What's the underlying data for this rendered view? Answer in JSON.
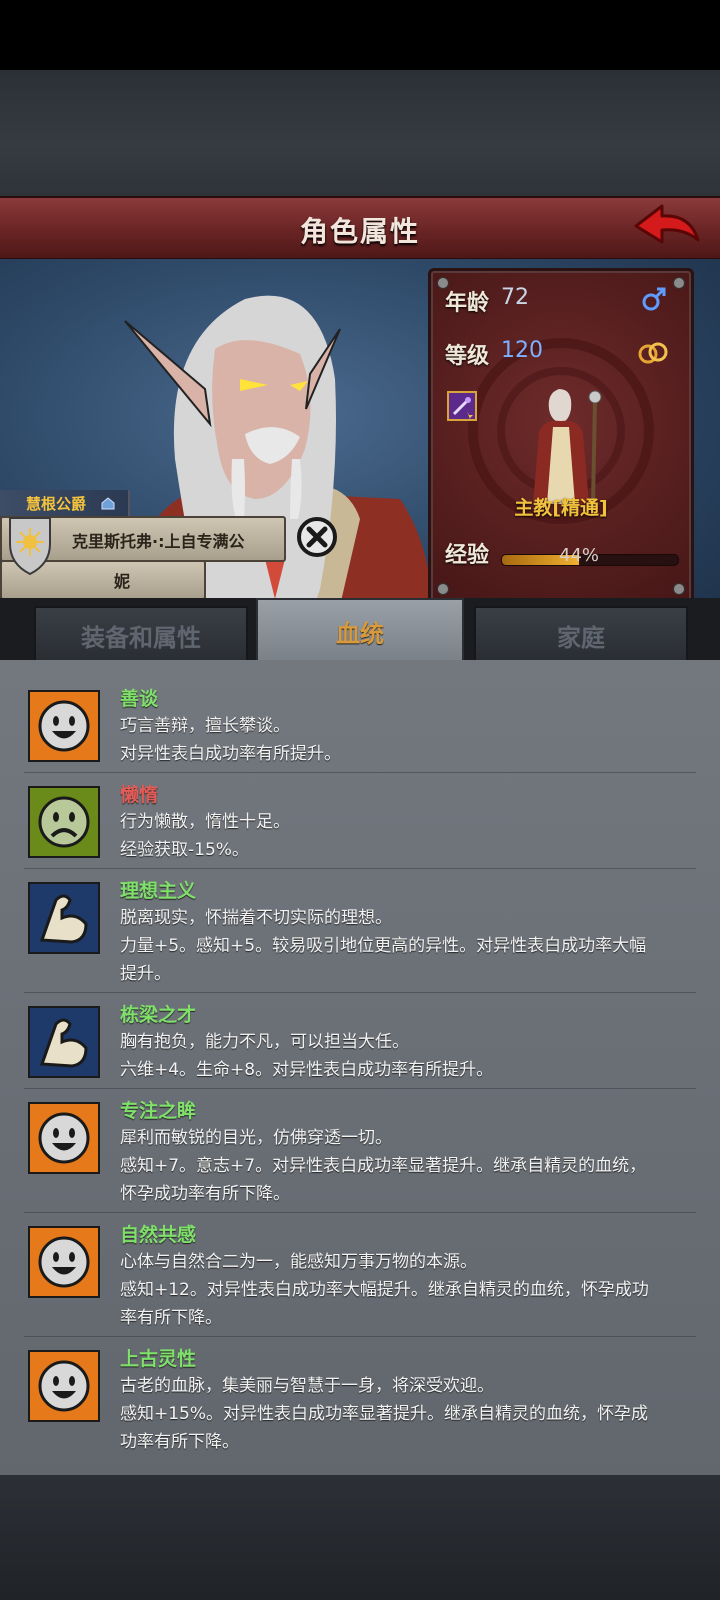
{
  "header": {
    "title": "角色属性"
  },
  "stats": {
    "age_label": "年龄",
    "age_value": "72",
    "level_label": "等级",
    "level_value": "120",
    "rank": "主教[精通]",
    "exp_label": "经验",
    "exp_pct": "44%",
    "exp_fraction": 0.44
  },
  "character": {
    "house": "慧根公爵",
    "name_line1": "克里斯托弗·:上自专满公",
    "name_line2": "妮"
  },
  "tabs": [
    {
      "label": "装备和属性"
    },
    {
      "label": "血统"
    },
    {
      "label": "家庭"
    }
  ],
  "active_tab": "血统",
  "traits": [
    {
      "name": "善谈",
      "icon": "smile-face-icon",
      "negative": false,
      "lines": "巧言善辩，擅长攀谈。\n对异性表白成功率有所提升。"
    },
    {
      "name": "懒惰",
      "icon": "sad-face-icon",
      "negative": true,
      "lines": "行为懒散，惰性十足。\n经验获取-15%。"
    },
    {
      "name": "理想主义",
      "icon": "muscle-arm-icon",
      "negative": false,
      "lines": "脱离现实，怀揣着不切实际的理想。\n力量+5。感知+5。较易吸引地位更高的异性。对异性表白成功率大幅\n提升。"
    },
    {
      "name": "栋梁之才",
      "icon": "muscle-arm-icon",
      "negative": false,
      "lines": "胸有抱负，能力不凡，可以担当大任。\n六维+4。生命+8。对异性表白成功率有所提升。"
    },
    {
      "name": "专注之眸",
      "icon": "smile-face-icon",
      "negative": false,
      "lines": "犀利而敏锐的目光，仿佛穿透一切。\n感知+7。意志+7。对异性表白成功率显著提升。继承自精灵的血统，\n怀孕成功率有所下降。"
    },
    {
      "name": "自然共感",
      "icon": "smile-face-icon",
      "negative": false,
      "lines": "心体与自然合二为一，能感知万事万物的本源。\n感知+12。对异性表白成功率大幅提升。继承自精灵的血统，怀孕成功\n率有所下降。"
    },
    {
      "name": "上古灵性",
      "icon": "smile-face-icon",
      "negative": false,
      "lines": "古老的血脉，集美丽与智慧于一身，将深受欢迎。\n感知+15%。对异性表白成功率显著提升。继承自精灵的血统，怀孕成\n功率有所下降。"
    }
  ]
}
